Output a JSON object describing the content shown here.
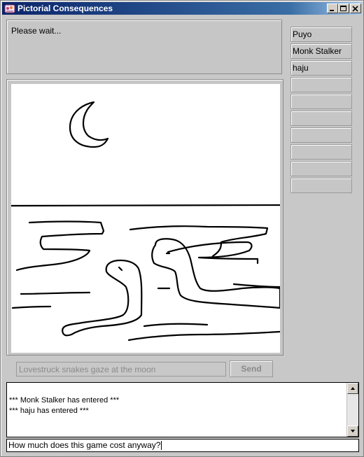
{
  "window": {
    "title": "Pictorial Consequences"
  },
  "status": {
    "text": "Please wait..."
  },
  "players": [
    "Puyo",
    "Monk Stalker",
    "haju",
    "",
    "",
    "",
    "",
    "",
    "",
    "",
    ""
  ],
  "caption": {
    "placeholder": "Lovestruck snakes gaze at the moon"
  },
  "send_button": {
    "label": "Send"
  },
  "chat": {
    "lines": [
      "*** Monk Stalker has entered ***",
      "*** haju has entered ***"
    ]
  },
  "chat_input": {
    "value": "How much does this game cost anyway?"
  },
  "icons": [
    "app-icon",
    "minimize-icon",
    "maximize-icon",
    "close-icon",
    "scroll-up-icon",
    "scroll-down-icon"
  ],
  "colors": {
    "titlebar_start": "#0a246a",
    "titlebar_end": "#a6caf0",
    "panel": "#c8c8c8"
  }
}
